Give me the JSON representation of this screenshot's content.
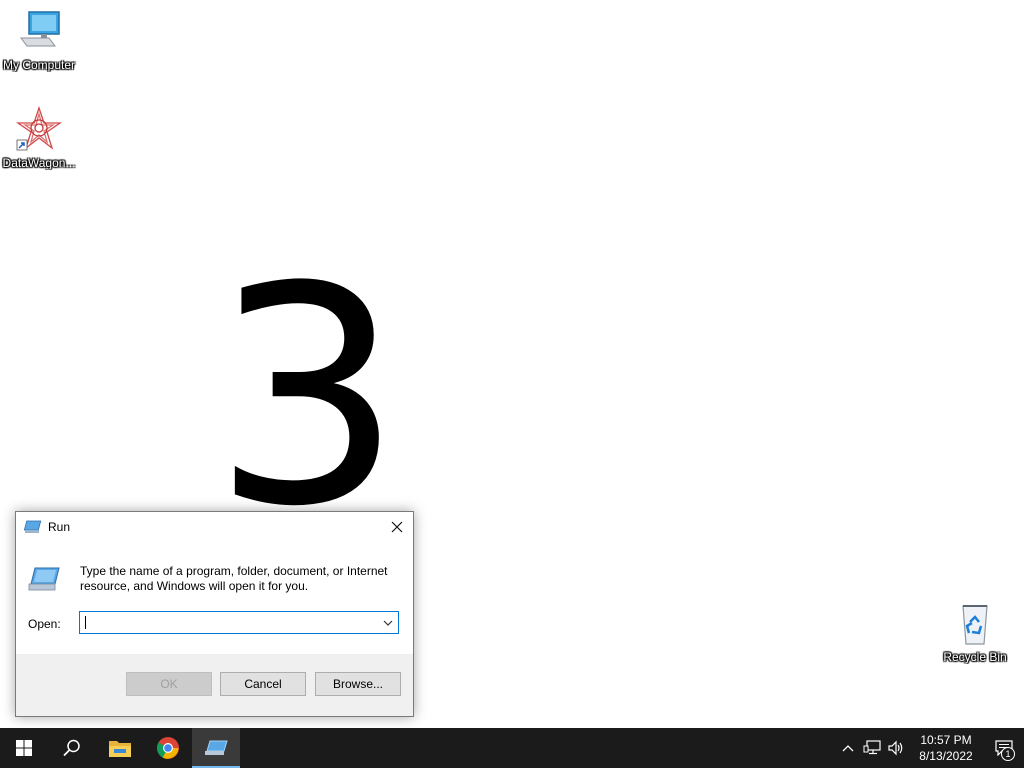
{
  "desktop": {
    "icons": [
      {
        "label": "My Computer",
        "icon": "computer-icon"
      },
      {
        "label": "DataWagon...",
        "icon": "datawagon-icon"
      },
      {
        "label": "Recycle Bin",
        "icon": "recycle-bin-icon"
      }
    ],
    "overlay_number": "3"
  },
  "run_dialog": {
    "title": "Run",
    "description": "Type the name of a program, folder, document, or Internet resource, and Windows will open it for you.",
    "open_label": "Open:",
    "open_value": "",
    "buttons": {
      "ok": "OK",
      "cancel": "Cancel",
      "browse": "Browse..."
    },
    "ok_disabled": true
  },
  "taskbar": {
    "pinned": [
      {
        "icon": "windows-start-icon"
      },
      {
        "icon": "search-icon"
      },
      {
        "icon": "file-explorer-icon"
      },
      {
        "icon": "chrome-icon"
      },
      {
        "icon": "run-app-icon",
        "active": true
      }
    ],
    "tray": {
      "time": "10:57 PM",
      "date": "8/13/2022",
      "notification_count": "1"
    }
  },
  "colors": {
    "taskbar_bg": "#1b1b1b",
    "accent": "#0078d7",
    "active_indicator": "#76b9ed"
  }
}
